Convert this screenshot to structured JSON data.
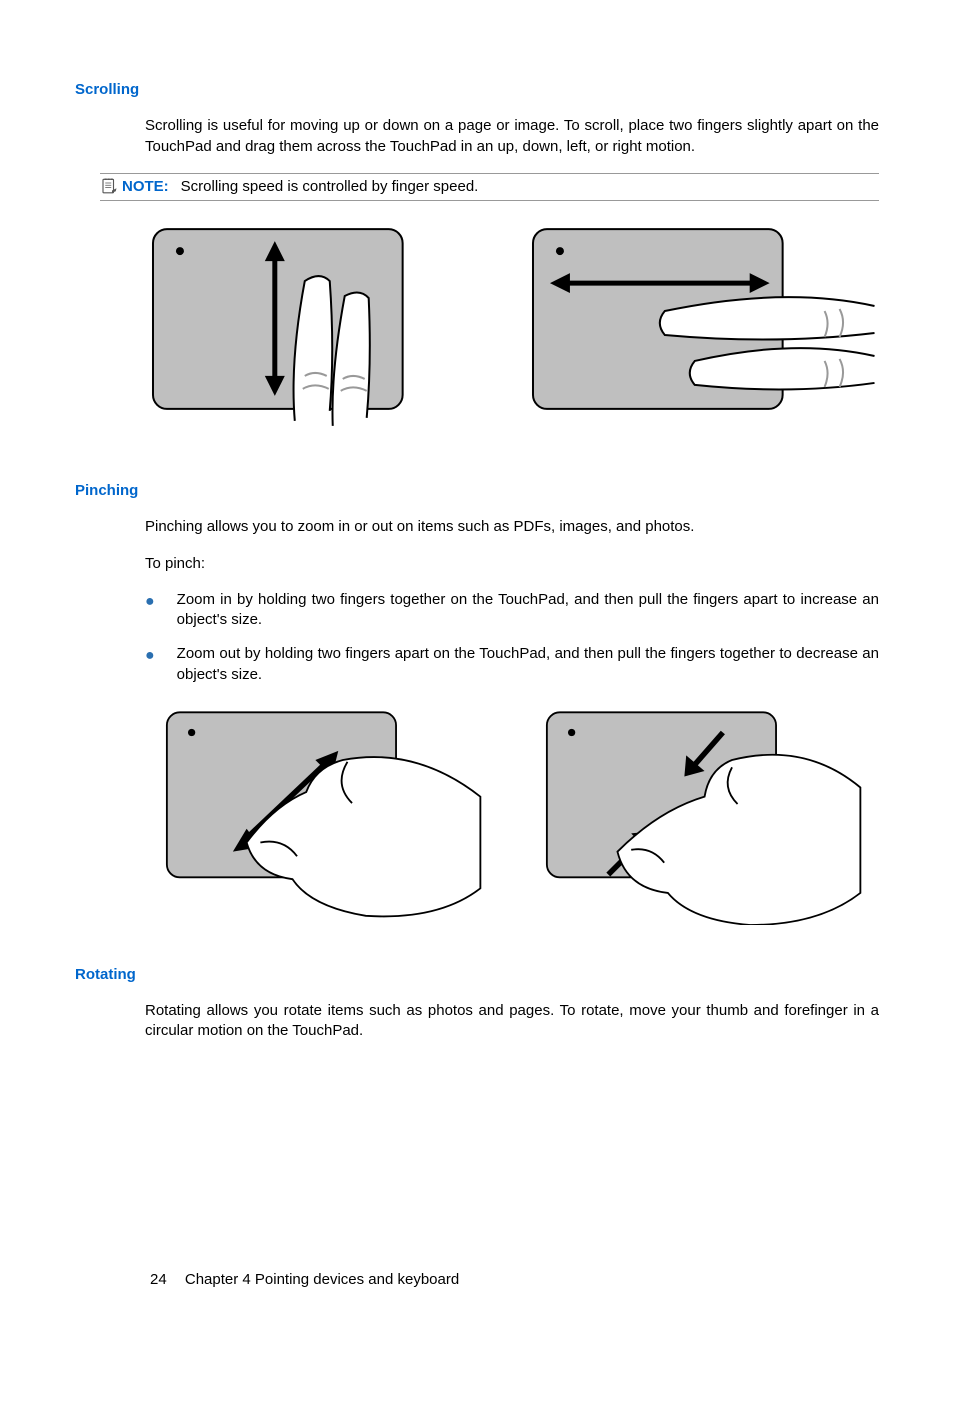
{
  "sections": {
    "scrolling": {
      "heading": "Scrolling",
      "para": "Scrolling is useful for moving up or down on a page or image. To scroll, place two fingers slightly apart on the TouchPad and drag them across the TouchPad in an up, down, left, or right motion.",
      "note_label": "NOTE:",
      "note_text": "Scrolling speed is controlled by finger speed."
    },
    "pinching": {
      "heading": "Pinching",
      "para1": "Pinching allows you to zoom in or out on items such as PDFs, images, and photos.",
      "para2": "To pinch:",
      "bullets": [
        "Zoom in by holding two fingers together on the TouchPad, and then pull the fingers apart to increase an object's size.",
        "Zoom out by holding two fingers apart on the TouchPad, and then pull the fingers together to decrease an object's size."
      ]
    },
    "rotating": {
      "heading": "Rotating",
      "para": "Rotating allows you rotate items such as photos and pages. To rotate, move your thumb and forefinger in a circular motion on the TouchPad."
    }
  },
  "footer": {
    "page": "24",
    "chapter": "Chapter 4   Pointing devices and keyboard"
  }
}
